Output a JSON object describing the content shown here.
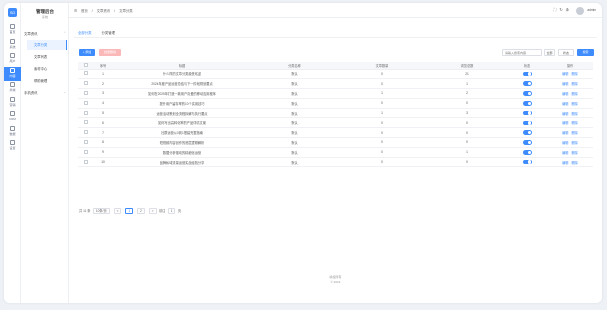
{
  "app": {
    "logo_text": "SD",
    "brand": "管理后台",
    "brand_sub": "系统"
  },
  "rail": [
    {
      "label": "首页",
      "icon": "home-icon"
    },
    {
      "label": "系统",
      "icon": "setting-icon"
    },
    {
      "label": "用户",
      "icon": "user-icon"
    },
    {
      "label": "内容",
      "icon": "content-icon",
      "active": true
    },
    {
      "label": "商城",
      "icon": "shop-icon"
    },
    {
      "label": "营销",
      "icon": "marketing-icon"
    },
    {
      "label": "CRM",
      "icon": "crm-icon"
    },
    {
      "label": "数据",
      "icon": "data-icon"
    },
    {
      "label": "设置",
      "icon": "gear-icon"
    }
  ],
  "sidebar": {
    "group1": "文章资讯",
    "items": [
      "文章分类",
      "文章列表",
      "素材中心",
      "帮助管理"
    ],
    "group2": "手机资讯"
  },
  "topbar": {
    "crumbs": [
      "首页",
      "文章资讯",
      "文章分类"
    ],
    "username": "admin"
  },
  "tabs": [
    "全部分类",
    "分类管理"
  ],
  "toolbar": {
    "add_label": "+ 添加",
    "delete_label": "批量删除",
    "search_placeholder": "请输入搜索内容",
    "select1": "全部",
    "select2": "状态",
    "search_label": "搜索"
  },
  "table": {
    "headers": [
      "",
      "序号",
      "标题",
      "分类名称",
      "文章数量",
      "浏览总数",
      "状态",
      "操作"
    ],
    "rows": [
      {
        "no": "1",
        "title": "什么样的文章分类最受欢迎",
        "cat": "默认",
        "count": "0",
        "views": "21"
      },
      {
        "no": "2",
        "title": "2024年度产品运营总结与下一阶段规划要点",
        "cat": "默认",
        "count": "0",
        "views": "1"
      },
      {
        "no": "3",
        "title": "如何在2025年打造一款用户喜爱的移动应用程序",
        "cat": "默认",
        "count": "1",
        "views": "2"
      },
      {
        "no": "4",
        "title": "提升用户留存率的10个实用技巧",
        "cat": "默认",
        "count": "0",
        "views": "0"
      },
      {
        "no": "5",
        "title": "运营活动策划全流程拆解与执行要点",
        "cat": "默认",
        "count": "1",
        "views": "3"
      },
      {
        "no": "6",
        "title": "如何写出高转化率的产品详情文案",
        "cat": "默认",
        "count": "0",
        "views": "0"
      },
      {
        "no": "7",
        "title": "社群运营从0到1搭建完整指南",
        "cat": "默认",
        "count": "0",
        "views": "0"
      },
      {
        "no": "8",
        "title": "短视频内容创作的底层逻辑解析",
        "cat": "默认",
        "count": "0",
        "views": "0"
      },
      {
        "no": "9",
        "title": "数据分析驱动的精细化运营",
        "cat": "默认",
        "count": "0",
        "views": "1"
      },
      {
        "no": "10",
        "title": "品牌私域流量运营实战经验分享",
        "cat": "默认",
        "count": "0",
        "views": "0"
      }
    ],
    "edit_label": "编辑",
    "delete_label": "删除"
  },
  "pager": {
    "total": "共 11 条",
    "size": "10条/页",
    "prev": "<",
    "pages": [
      "1",
      "2"
    ],
    "next": ">",
    "goto": "前往",
    "goto_value": "1",
    "page_unit": "页"
  },
  "footer": {
    "line1": "版权所有",
    "line2": "© 2024"
  },
  "colors": {
    "accent": "#3d8bfd",
    "danger_light": "#fbb8b8"
  }
}
